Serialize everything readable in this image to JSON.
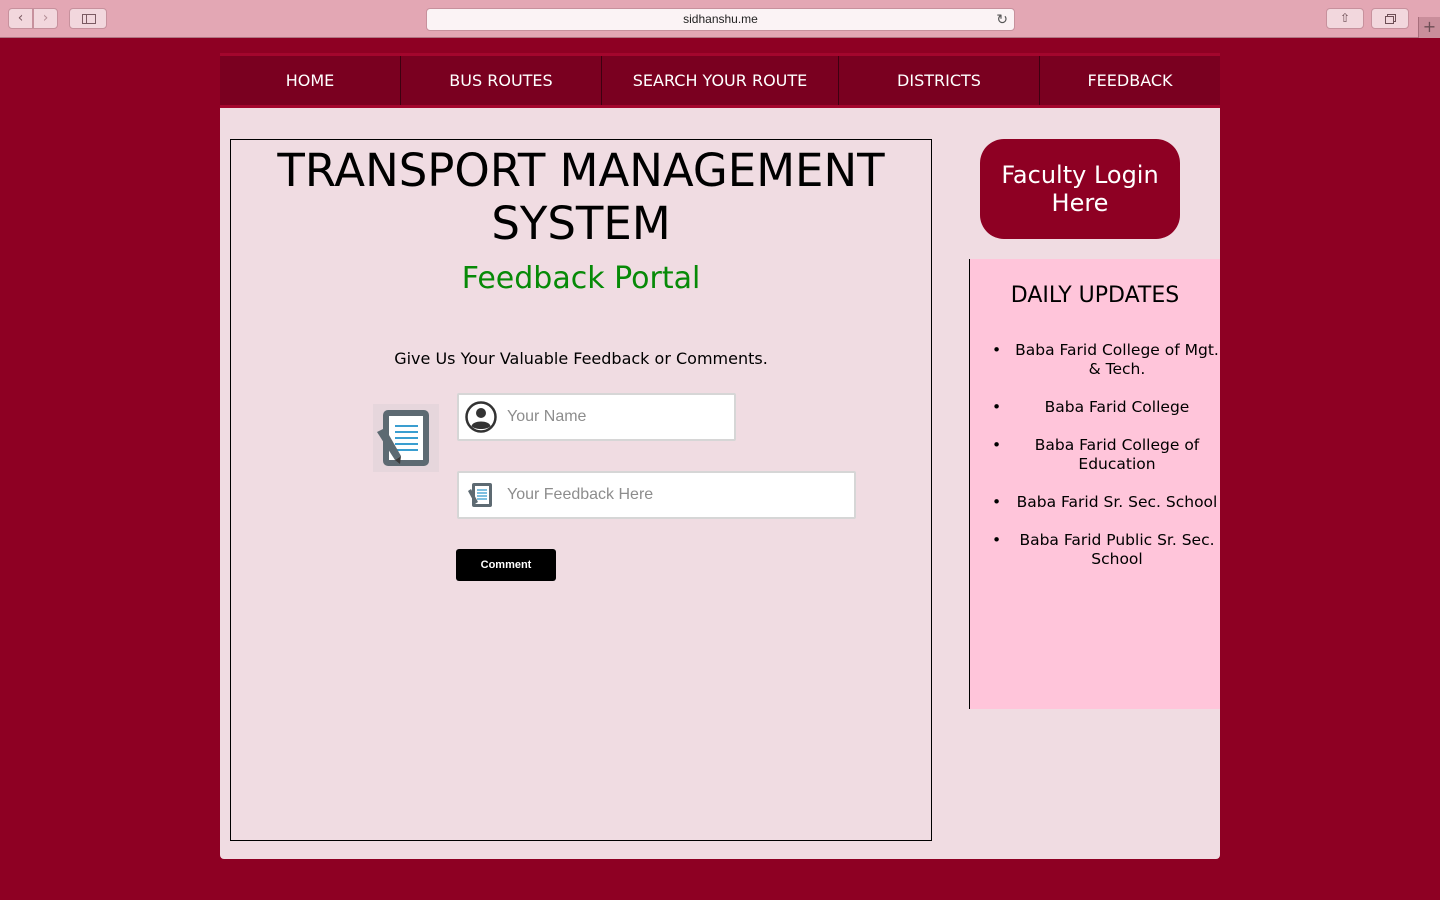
{
  "browser": {
    "url": "sidhanshu.me",
    "back_glyph": "‹",
    "forward_glyph": "›",
    "reload_glyph": "↻",
    "share_glyph": "⇧",
    "newtab_glyph": "+"
  },
  "nav": {
    "items": [
      {
        "label": "HOME"
      },
      {
        "label": "BUS ROUTES"
      },
      {
        "label": "SEARCH YOUR ROUTE"
      },
      {
        "label": "DISTRICTS"
      },
      {
        "label": "FEEDBACK"
      }
    ]
  },
  "main": {
    "title": "TRANSPORT MANAGEMENT SYSTEM",
    "subtitle": "Feedback Portal",
    "prompt": "Give Us Your Valuable Feedback or Comments.",
    "name_field": {
      "placeholder": "Your Name",
      "value": "",
      "icon": "user-circle-icon"
    },
    "feedback_field": {
      "placeholder": "Your Feedback Here",
      "value": "",
      "icon": "notepad-icon"
    },
    "comment_button": "Comment",
    "form_icon": "notepad-pencil-icon"
  },
  "sidebar": {
    "login_button": "Faculty Login Here",
    "updates_title": "DAILY UPDATES",
    "updates": [
      "Baba Farid College of Mgt. & Tech.",
      "Baba Farid College",
      "Baba Farid College of Education",
      "Baba Farid Sr. Sec. School",
      "Baba Farid Public Sr. Sec. School"
    ]
  },
  "colors": {
    "background": "#8e0023",
    "nav_bg": "#7a0020",
    "content_bg": "#f0dce2",
    "updates_bg": "#ffc5da",
    "subtitle": "#078a07",
    "button_black": "#000000"
  }
}
